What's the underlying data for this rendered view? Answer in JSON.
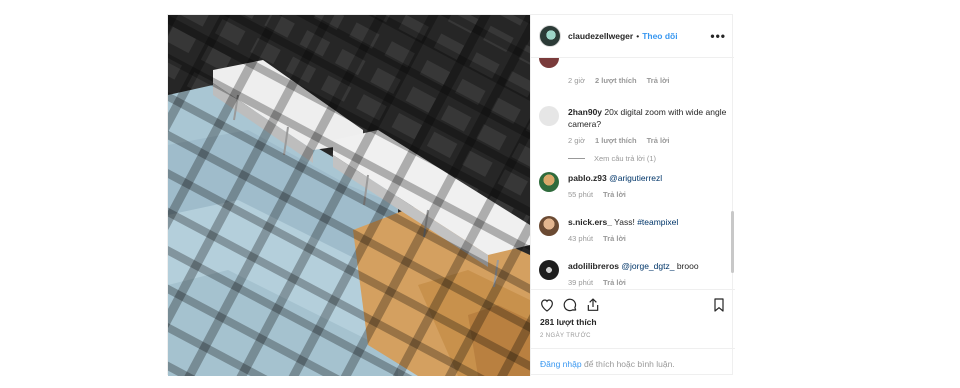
{
  "post": {
    "owner": "claudezellweger",
    "separator": "•",
    "follow_label": "Theo dõi",
    "more_label": "•••"
  },
  "comments": [
    {
      "user": "",
      "text": "",
      "time": "2 giờ",
      "likes": "2 lượt thích",
      "reply": "Trả lời",
      "avatar_color": "#7a3b3b"
    },
    {
      "user": "2han90y",
      "text": "20x digital zoom with wide angle camera?",
      "time": "2 giờ",
      "likes": "1 lượt thích",
      "reply": "Trả lời",
      "avatar_color": "#e0e0e0"
    },
    {
      "user": "pablo.z93",
      "mention": "@arigutierrezl",
      "after": "",
      "time": "55 phút",
      "reply": "Trả lời",
      "avatar_color": "#2f6b3c"
    },
    {
      "user": "s.nick.ers_",
      "text": "Yass!",
      "mention": "#teampixel",
      "time": "43 phút",
      "reply": "Trả lời",
      "avatar_color": "#8a5a3a"
    },
    {
      "user": "adolilibreros",
      "mention": "@jorge_dgtz_",
      "after": "brooo",
      "time": "39 phút",
      "reply": "Trả lời",
      "avatar_color": "#1e1e1e"
    }
  ],
  "view_replies": "Xem câu trả lời (1)",
  "actions": {
    "like_icon": "heart-icon",
    "comment_icon": "comment-icon",
    "share_icon": "share-icon",
    "save_icon": "bookmark-icon"
  },
  "likes_count": "281 lượt thích",
  "posted_time": "2 NGÀY TRƯỚC",
  "login": {
    "link": "Đăng nhập",
    "rest": "để thích hoặc bình luận."
  }
}
